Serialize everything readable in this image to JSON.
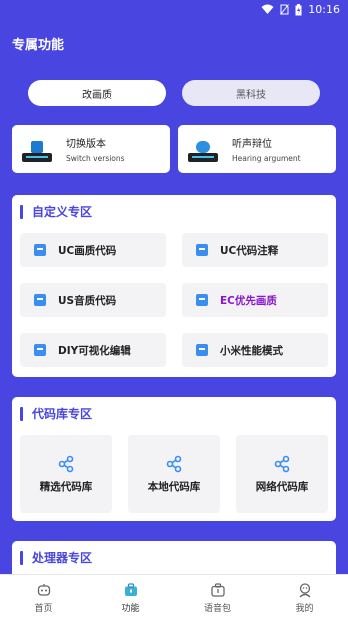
{
  "status_bar": {
    "time": "10:16"
  },
  "header": {
    "title": "专属功能"
  },
  "buttons": {
    "left": "改画质",
    "right": "黑科技"
  },
  "modes": [
    {
      "title": "切换版本",
      "subtitle": "Switch versions",
      "icon": "controller-device-icon"
    },
    {
      "title": "听声辩位",
      "subtitle": "Hearing argument",
      "icon": "hearing-device-icon"
    }
  ],
  "custom_section": {
    "title": "自定义专区",
    "items": [
      {
        "label": "UC画质代码"
      },
      {
        "label": "UC代码注释"
      },
      {
        "label": "US音质代码"
      },
      {
        "label": "EC优先画质"
      },
      {
        "label": "DIY可视化编辑"
      },
      {
        "label": "小米性能模式"
      }
    ]
  },
  "repo_section": {
    "title": "代码库专区",
    "items": [
      {
        "label": "精选代码库"
      },
      {
        "label": "本地代码库"
      },
      {
        "label": "网络代码库"
      }
    ]
  },
  "processor_section": {
    "title": "处理器专区"
  },
  "nav": [
    {
      "label": "首页"
    },
    {
      "label": "功能"
    },
    {
      "label": "语音包"
    },
    {
      "label": "我的"
    }
  ],
  "colors": {
    "accent": "#4845e0",
    "highlight_text": "#8a17c9",
    "doc_icon": "#3a8ef2"
  }
}
